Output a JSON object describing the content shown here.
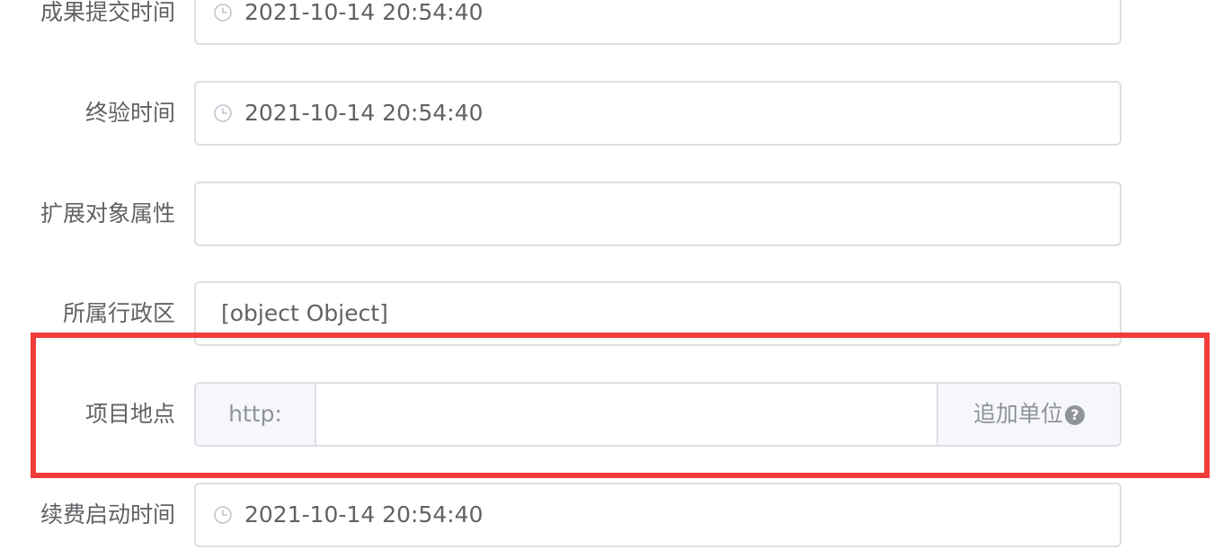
{
  "form": {
    "rows": [
      {
        "label": "成果提交时间",
        "value": "2021-10-14 20:54:40",
        "icon": "clock-icon"
      },
      {
        "label": "终验时间",
        "value": "2021-10-14 20:54:40",
        "icon": "clock-icon"
      },
      {
        "label": "扩展对象属性",
        "value": ""
      },
      {
        "label": "所属行政区",
        "value": "[object Object]"
      },
      {
        "label": "项目地点",
        "prepend": "http:",
        "value": "",
        "append": "追加单位",
        "append_icon": "question-circle-icon"
      },
      {
        "label": "续费启动时间",
        "value": "2021-10-14 20:54:40",
        "icon": "clock-icon"
      }
    ]
  },
  "colors": {
    "border": "#dcdfe6",
    "addon_bg": "#f5f7fa",
    "label_text": "#606266",
    "addon_text": "#909399",
    "highlight": "#f23b3b"
  }
}
